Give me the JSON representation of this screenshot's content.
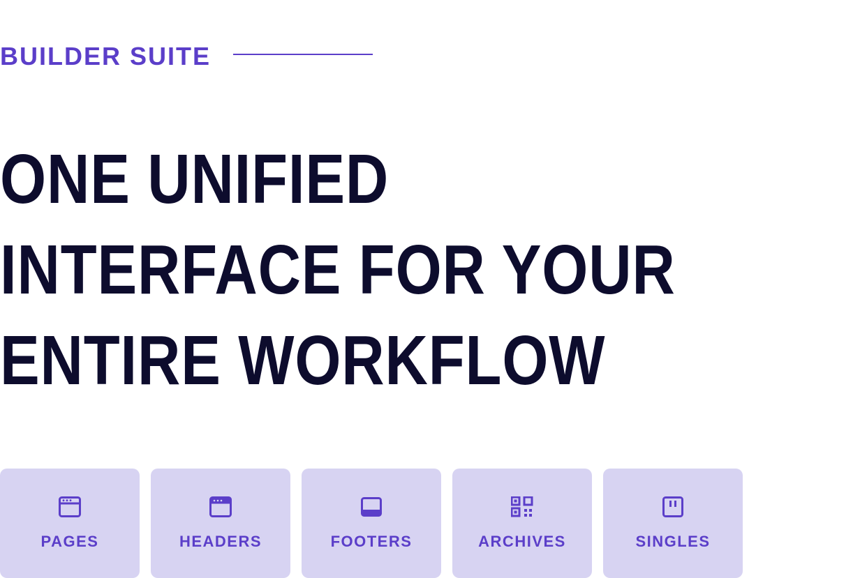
{
  "eyebrow": "BUILDER SUITE",
  "title": "ONE UNIFIED INTERFACE FOR YOUR ENTIRE WORKFLOW",
  "colors": {
    "accent": "#5B3EC9",
    "heading": "#0D0C2D",
    "card_bg": "#D7D3F2"
  },
  "cards": [
    {
      "label": "PAGES",
      "icon": "window-icon"
    },
    {
      "label": "HEADERS",
      "icon": "header-bar-icon"
    },
    {
      "label": "FOOTERS",
      "icon": "footer-bar-icon"
    },
    {
      "label": "ARCHIVES",
      "icon": "grid-icon"
    },
    {
      "label": "SINGLES",
      "icon": "single-panel-icon"
    }
  ]
}
